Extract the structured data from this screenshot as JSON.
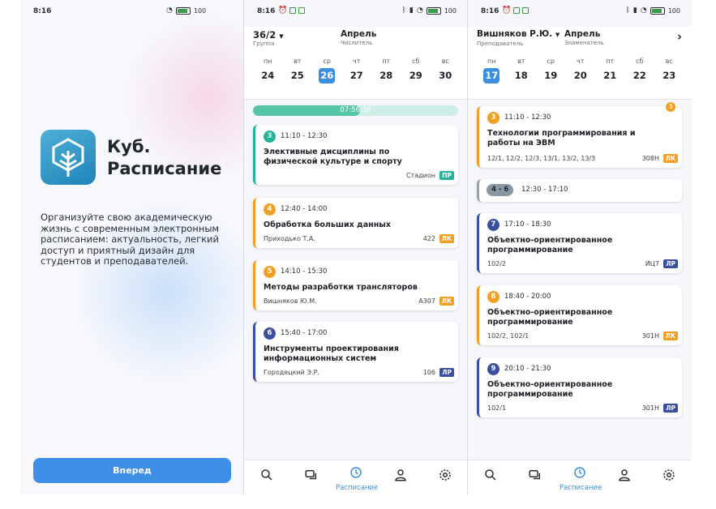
{
  "status": {
    "time": "8:16",
    "battery": "100"
  },
  "splash": {
    "title_line1": "Куб.",
    "title_line2": "Расписание",
    "description": "Организуйте свою академическую жизнь с современным электронным расписанием: актуальность, легкий доступ и приятный дизайн для студентов и преподавателей.",
    "button": "Вперед"
  },
  "group_screen": {
    "selector": "36/2",
    "selector_sub": "Группа",
    "month": "Апрель",
    "week": "Числитель",
    "days": [
      {
        "name": "пн",
        "date": "24"
      },
      {
        "name": "вт",
        "date": "25"
      },
      {
        "name": "ср",
        "date": "26",
        "selected": true
      },
      {
        "name": "чт",
        "date": "27"
      },
      {
        "name": "пт",
        "date": "28"
      },
      {
        "name": "сб",
        "date": "29"
      },
      {
        "name": "вс",
        "date": "30"
      }
    ],
    "progress": {
      "text": "07:56:30",
      "fraction": 0.52
    },
    "classes": [
      {
        "num": "3",
        "time": "11:10 - 12:30",
        "title": "Элективные дисциплины по физической культуре и спорту",
        "who": "",
        "room": "Стадион",
        "type": "ПР"
      },
      {
        "num": "4",
        "time": "12:40 - 14:00",
        "title": "Обработка больших данных",
        "who": "Приходько Т.А.",
        "room": "422",
        "type": "ЛК"
      },
      {
        "num": "5",
        "time": "14:10 - 15:30",
        "title": "Методы разработки трансляторов",
        "who": "Вишняков Ю.М.",
        "room": "А307",
        "type": "ЛК"
      },
      {
        "num": "6",
        "time": "15:40 - 17:00",
        "title": "Инструменты проектирования информационных систем",
        "who": "Городецкий Э.Р.",
        "room": "106",
        "type": "ЛР"
      }
    ]
  },
  "teacher_screen": {
    "selector": "Вишняков Р.Ю.",
    "selector_sub": "Преподаватель",
    "month": "Апрель",
    "week": "Знаменатель",
    "days": [
      {
        "name": "пн",
        "date": "17",
        "selected": true
      },
      {
        "name": "вт",
        "date": "18"
      },
      {
        "name": "ср",
        "date": "19"
      },
      {
        "name": "чт",
        "date": "20"
      },
      {
        "name": "пт",
        "date": "21"
      },
      {
        "name": "сб",
        "date": "22"
      },
      {
        "name": "вс",
        "date": "23"
      }
    ],
    "classes": [
      {
        "num": "3",
        "time": "11:10 - 12:30",
        "title": "Технологии программирования и работы на ЭВМ",
        "who": "12/1, 12/2, 12/3, 13/1, 13/2, 13/3",
        "room": "308Н",
        "type": "ЛК",
        "badge": "3"
      },
      {
        "num": "7",
        "time": "17:10 - 18:30",
        "title": "Объектно-ориентированное программирование",
        "who": "102/2",
        "room": "ИЦ7",
        "type": "ЛР"
      },
      {
        "num": "8",
        "time": "18:40 - 20:00",
        "title": "Объектно-ориентированное программирование",
        "who": "102/2, 102/1",
        "room": "301Н",
        "type": "ЛК"
      },
      {
        "num": "9",
        "time": "20:10 - 21:30",
        "title": "Объектно-ориентированное программирование",
        "who": "102/1",
        "room": "301Н",
        "type": "ЛР"
      }
    ],
    "break": {
      "num": "4 - 6",
      "time": "12:30 - 17:10"
    }
  },
  "nav": {
    "schedule_label": "Расписание"
  },
  "colors": {
    "accent": "#3a8fde",
    "pr": "#22b59a",
    "lk": "#f2a024",
    "lr": "#3a4f9e"
  }
}
